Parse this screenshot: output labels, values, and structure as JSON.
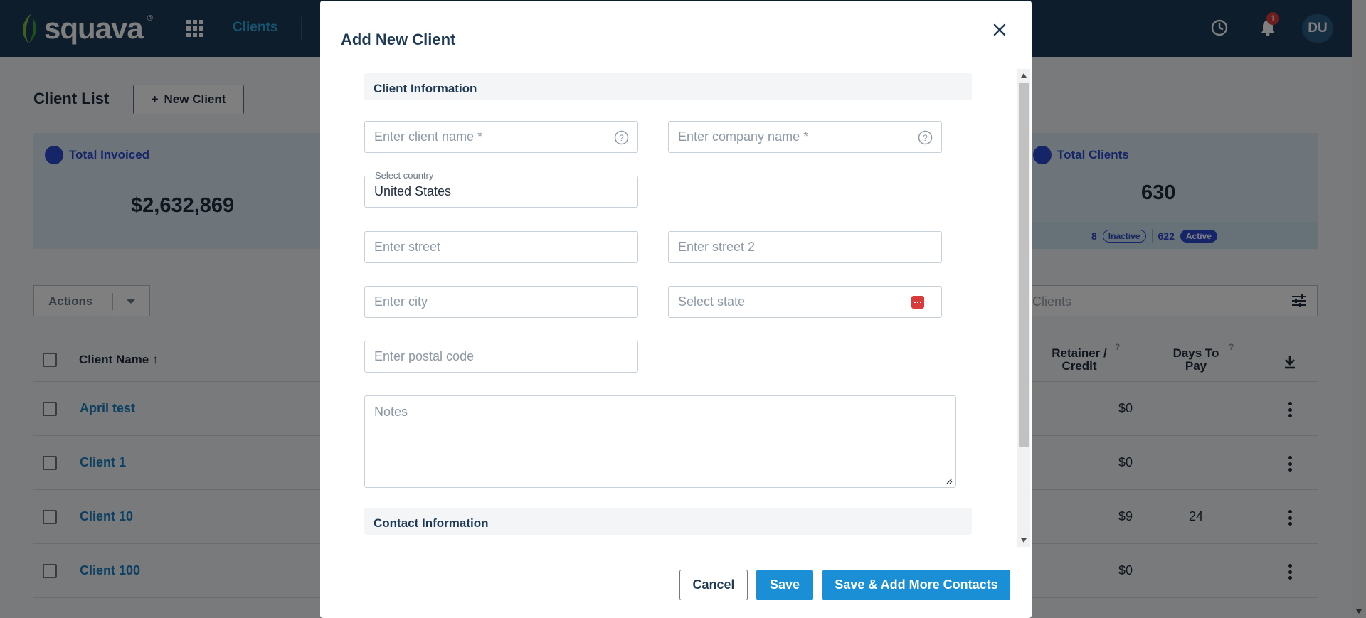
{
  "app": {
    "logo_text": "squava",
    "logo_mark": "®",
    "nav_active": "Clients",
    "notification_count": "1",
    "avatar_initials": "DU"
  },
  "page": {
    "title": "Client List",
    "new_client_label": "New Client",
    "stats": {
      "invoiced_label": "Total Invoiced",
      "invoiced_value": "$2,632,869",
      "clients_label": "Total Clients",
      "clients_value": "630",
      "inactive_count": "8",
      "inactive_label": "Inactive",
      "active_count": "622",
      "active_label": "Active"
    },
    "actions_label": "Actions",
    "search_placeholder": "Clients",
    "table": {
      "col_client_name": "Client Name",
      "col_retainer": "Retainer / Credit",
      "col_days": "Days To Pay",
      "help_mark": "?",
      "rows": [
        {
          "name": "April test",
          "retainer": "$0",
          "days": ""
        },
        {
          "name": "Client 1",
          "retainer": "$0",
          "days": ""
        },
        {
          "name": "Client 10",
          "retainer": "$9",
          "days": "24"
        },
        {
          "name": "Client 100",
          "retainer": "$0",
          "days": ""
        }
      ]
    }
  },
  "modal": {
    "title": "Add New Client",
    "section_client_info": "Client Information",
    "client_name_placeholder": "Enter client name *",
    "company_name_placeholder": "Enter company name *",
    "country_label": "Select country",
    "country_value": "United States",
    "street_placeholder": "Enter street",
    "street2_placeholder": "Enter street 2",
    "city_placeholder": "Enter city",
    "state_placeholder": "Select state",
    "postal_placeholder": "Enter postal code",
    "notes_placeholder": "Notes",
    "section_contact_info": "Contact Information",
    "cancel_label": "Cancel",
    "save_label": "Save",
    "save_more_label": "Save & Add More Contacts"
  },
  "colors": {
    "topbar": "#1c3b57",
    "accent": "#1a8fd6",
    "link": "#1a7fc1",
    "stat_accent": "#2b4bd1"
  }
}
